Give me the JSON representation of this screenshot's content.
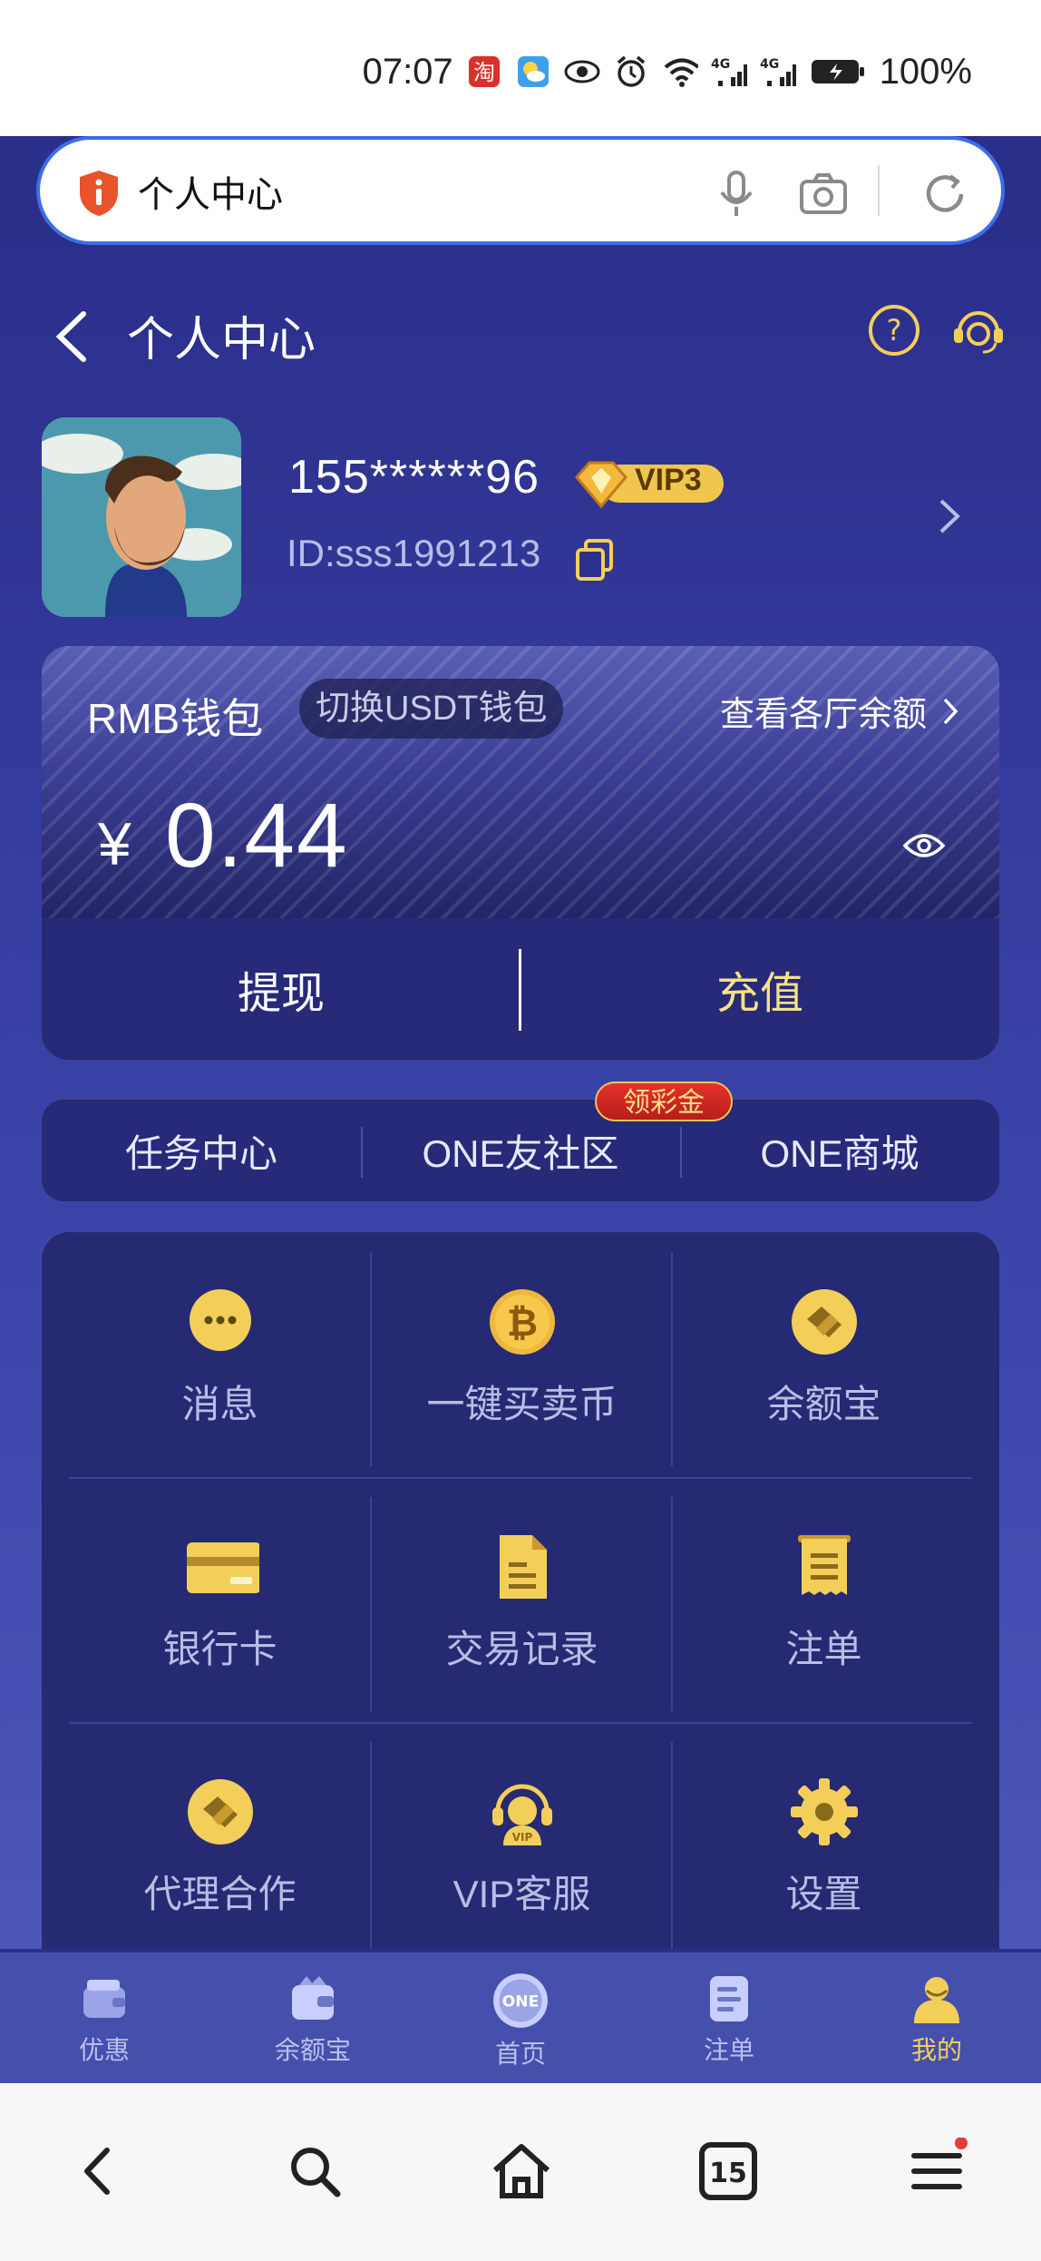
{
  "status": {
    "time": "07:07",
    "battery": "100%"
  },
  "browser": {
    "url_text": "个人中心"
  },
  "header": {
    "title": "个人中心"
  },
  "user": {
    "phone": "155******96",
    "vip": "VIP3",
    "id": "ID:sss1991213"
  },
  "wallet": {
    "title": "RMB钱包",
    "switch_label": "切换USDT钱包",
    "view_all": "查看各厅余额",
    "currency": "¥",
    "amount": "0.44",
    "withdraw": "提现",
    "recharge": "充值"
  },
  "tabs": [
    {
      "label": "任务中心"
    },
    {
      "label": "ONE友社区"
    },
    {
      "label": "ONE商城"
    }
  ],
  "tab_badge": "领彩金",
  "grid": [
    {
      "label": "消息",
      "icon": "message-icon"
    },
    {
      "label": "一键买卖币",
      "icon": "bitcoin-icon"
    },
    {
      "label": "余额宝",
      "icon": "handshake-icon"
    },
    {
      "label": "银行卡",
      "icon": "bank-card-icon"
    },
    {
      "label": "交易记录",
      "icon": "document-icon"
    },
    {
      "label": "注单",
      "icon": "receipt-icon"
    },
    {
      "label": "代理合作",
      "icon": "handshake-icon"
    },
    {
      "label": "VIP客服",
      "icon": "vip-support-icon"
    },
    {
      "label": "设置",
      "icon": "gear-icon"
    }
  ],
  "bottom_nav": [
    {
      "label": "优惠"
    },
    {
      "label": "余额宝"
    },
    {
      "label": "首页"
    },
    {
      "label": "注单"
    },
    {
      "label": "我的"
    }
  ],
  "browser_nav": {
    "tabs_count": "15"
  },
  "colors": {
    "accent_gold": "#f3cf5a",
    "bg_navy": "#2a2f8a",
    "url_border": "#3b6ee8"
  }
}
